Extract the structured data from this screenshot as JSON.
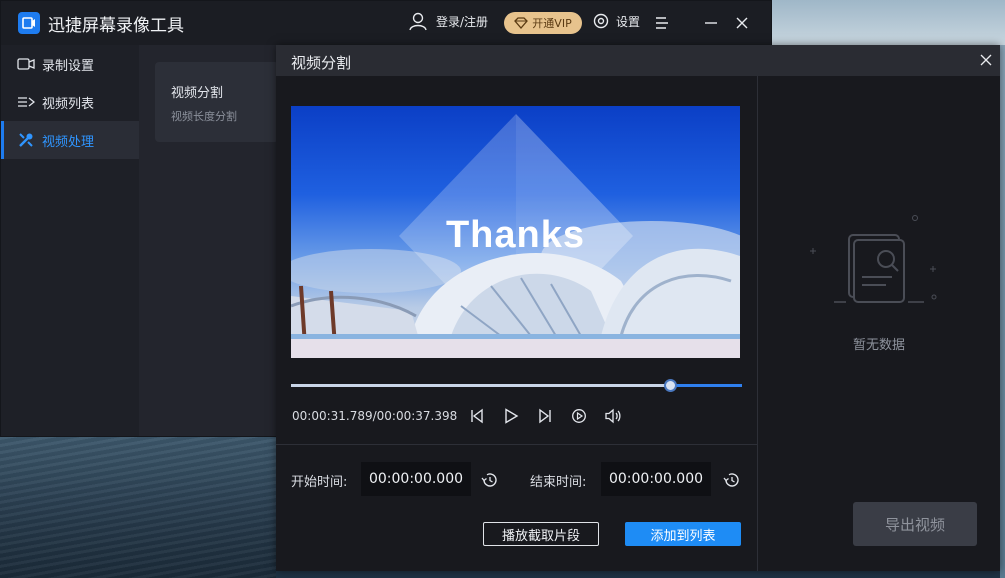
{
  "app": {
    "title": "迅捷屏幕录像工具",
    "user_label": "登录/注册",
    "vip_label": "开通VIP",
    "settings_label": "设置"
  },
  "sidebar": {
    "items": [
      {
        "label": "录制设置",
        "icon": "camera-icon"
      },
      {
        "label": "视频列表",
        "icon": "list-icon"
      },
      {
        "label": "视频处理",
        "icon": "tools-icon",
        "active": true
      }
    ]
  },
  "content": {
    "card_title": "视频分割",
    "card_subtitle": "视频长度分割"
  },
  "dialog": {
    "title": "视频分割",
    "video_overlay_text": "Thanks",
    "progress_fraction": 0.84,
    "time_readout": "00:00:31.789/00:00:37.398",
    "start_label": "开始时间:",
    "start_value": "00:00:00.000",
    "end_label": "结束时间:",
    "end_value": "00:00:00.000",
    "play_clip_label": "播放截取片段",
    "add_to_list_label": "添加到列表",
    "empty_text": "暂无数据",
    "export_label": "导出视频"
  },
  "colors": {
    "accent": "#1e8cf5",
    "vip_gold": "#e7c38d",
    "dialog_bg": "#18191e"
  }
}
